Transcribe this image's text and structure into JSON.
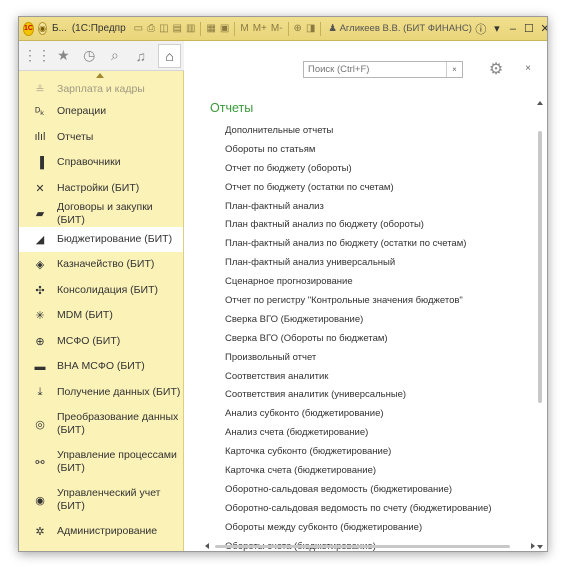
{
  "titlebar": {
    "app_short": "Б...",
    "app_full": "(1С:Предпр",
    "user": "Агликеев В.В. (БИТ ФИНАНС)",
    "tools": [
      "M",
      "M+",
      "M-"
    ]
  },
  "toolbar_icons": [
    "apps-grid-icon",
    "star-icon",
    "history-icon",
    "search-icon",
    "bell-icon",
    "home-icon"
  ],
  "sidebar": {
    "items": [
      {
        "label": "Зарплата и кадры",
        "icon": "salary-icon",
        "glyph": "≗"
      },
      {
        "label": "Операции",
        "icon": "operations-icon",
        "glyph": "ᴰₖ"
      },
      {
        "label": "Отчеты",
        "icon": "reports-icon",
        "glyph": "ılıl"
      },
      {
        "label": "Справочники",
        "icon": "catalogs-icon",
        "glyph": "▐"
      },
      {
        "label": "Настройки (БИТ)",
        "icon": "settings-tools-icon",
        "glyph": "✕"
      },
      {
        "label": "Договоры и закупки (БИТ)",
        "icon": "folder-icon",
        "glyph": "▰"
      },
      {
        "label": "Бюджетирование (БИТ)",
        "icon": "budget-chart-icon",
        "glyph": "◢"
      },
      {
        "label": "Казначейство (БИТ)",
        "icon": "treasury-icon",
        "glyph": "◈"
      },
      {
        "label": "Консолидация (БИТ)",
        "icon": "consolidation-icon",
        "glyph": "✣"
      },
      {
        "label": "MDM (БИТ)",
        "icon": "mdm-icon",
        "glyph": "✳"
      },
      {
        "label": "МСФО (БИТ)",
        "icon": "globe-icon",
        "glyph": "⊕"
      },
      {
        "label": "ВНА МСФО (БИТ)",
        "icon": "truck-icon",
        "glyph": "▬"
      },
      {
        "label": "Получение данных (БИТ)",
        "icon": "download-icon",
        "glyph": "⤓"
      },
      {
        "label": "Преобразование данных (БИТ)",
        "icon": "transform-icon",
        "glyph": "◎"
      },
      {
        "label": "Управление процессами (БИТ)",
        "icon": "process-icon",
        "glyph": "⚯"
      },
      {
        "label": "Управленческий учет (БИТ)",
        "icon": "management-icon",
        "glyph": "◉"
      },
      {
        "label": "Администрирование",
        "icon": "admin-gear-icon",
        "glyph": "✲"
      }
    ],
    "active_index": 6
  },
  "search": {
    "placeholder": "Поиск (Ctrl+F)",
    "clear": "×"
  },
  "close_label": "×",
  "section_title": "Отчеты",
  "reports": [
    "Дополнительные отчеты",
    "Обороты по статьям",
    "Отчет по бюджету (обороты)",
    "Отчет по бюджету (остатки по счетам)",
    "План-фактный анализ",
    "План фактный анализ по бюджету (обороты)",
    "План-фактный анализ по бюджету (остатки по счетам)",
    "План-фактный анализ универсальный",
    "Сценарное прогнозирование",
    "Отчет по регистру \"Контрольные значения бюджетов\"",
    "Сверка ВГО (Бюджетирование)",
    "Сверка ВГО (Обороты по бюджетам)",
    "Произвольный отчет",
    "Соответствия аналитик",
    "Соответствия аналитик (универсальные)",
    "Анализ субконто (бюджетирование)",
    "Анализ счета (бюджетирование)",
    "Карточка субконто (бюджетирование)",
    "Карточка счета (бюджетирование)",
    "Оборотно-сальдовая ведомость (бюджетирование)",
    "Оборотно-сальдовая ведомость по счету (бюджетирование)",
    "Обороты между субконто (бюджетирование)",
    "Обороты счета (бюджетирование)"
  ],
  "colors": {
    "sidebar_bg": "#fbf2b8",
    "titlebar_bg": "#e9d57a",
    "section_title": "#3a9a3a",
    "active_item_bg": "#ffffff"
  }
}
